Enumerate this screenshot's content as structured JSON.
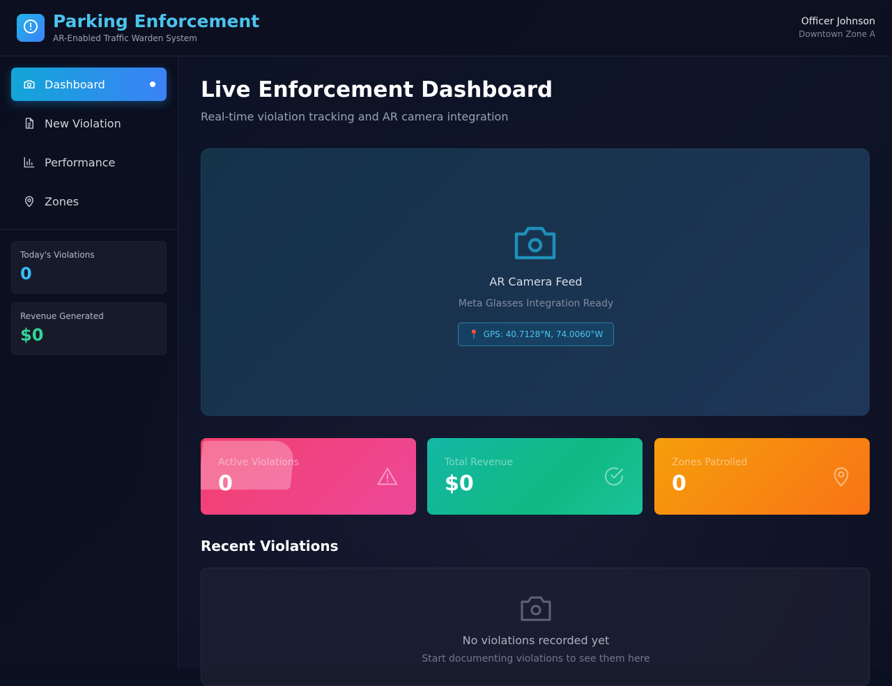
{
  "header": {
    "title": "Parking Enforcement",
    "subtitle": "AR-Enabled Traffic Warden System",
    "user_name": "Officer Johnson",
    "user_zone": "Downtown Zone A",
    "logo_icon": "alert-circle-icon"
  },
  "sidebar": {
    "items": [
      {
        "label": "Dashboard",
        "icon": "camera-icon",
        "active": true
      },
      {
        "label": "New Violation",
        "icon": "document-icon",
        "active": false
      },
      {
        "label": "Performance",
        "icon": "bar-chart-icon",
        "active": false
      },
      {
        "label": "Zones",
        "icon": "map-pin-icon",
        "active": false
      }
    ],
    "stats": [
      {
        "label": "Today's Violations",
        "value": "0",
        "color": "#38bdf8"
      },
      {
        "label": "Revenue Generated",
        "value": "$0",
        "color": "#34d399"
      }
    ]
  },
  "main": {
    "title": "Live Enforcement Dashboard",
    "subtitle": "Real-time violation tracking and AR camera integration",
    "camera": {
      "title": "AR Camera Feed",
      "subtitle": "Meta Glasses Integration Ready",
      "gps": "GPS: 40.7128°N, 74.0060°W",
      "icon": "camera-icon"
    },
    "cards": [
      {
        "label": "Active Violations",
        "value": "0",
        "icon": "warning-triangle-icon",
        "color": "#f43f6f"
      },
      {
        "label": "Total Revenue",
        "value": "$0",
        "icon": "check-circle-icon",
        "color": "#14b8a6"
      },
      {
        "label": "Zones Patrolled",
        "value": "0",
        "icon": "map-pin-icon",
        "color": "#f59e0b"
      }
    ],
    "recent": {
      "title": "Recent Violations",
      "empty_title": "No violations recorded yet",
      "empty_subtitle": "Start documenting violations to see them here"
    }
  }
}
